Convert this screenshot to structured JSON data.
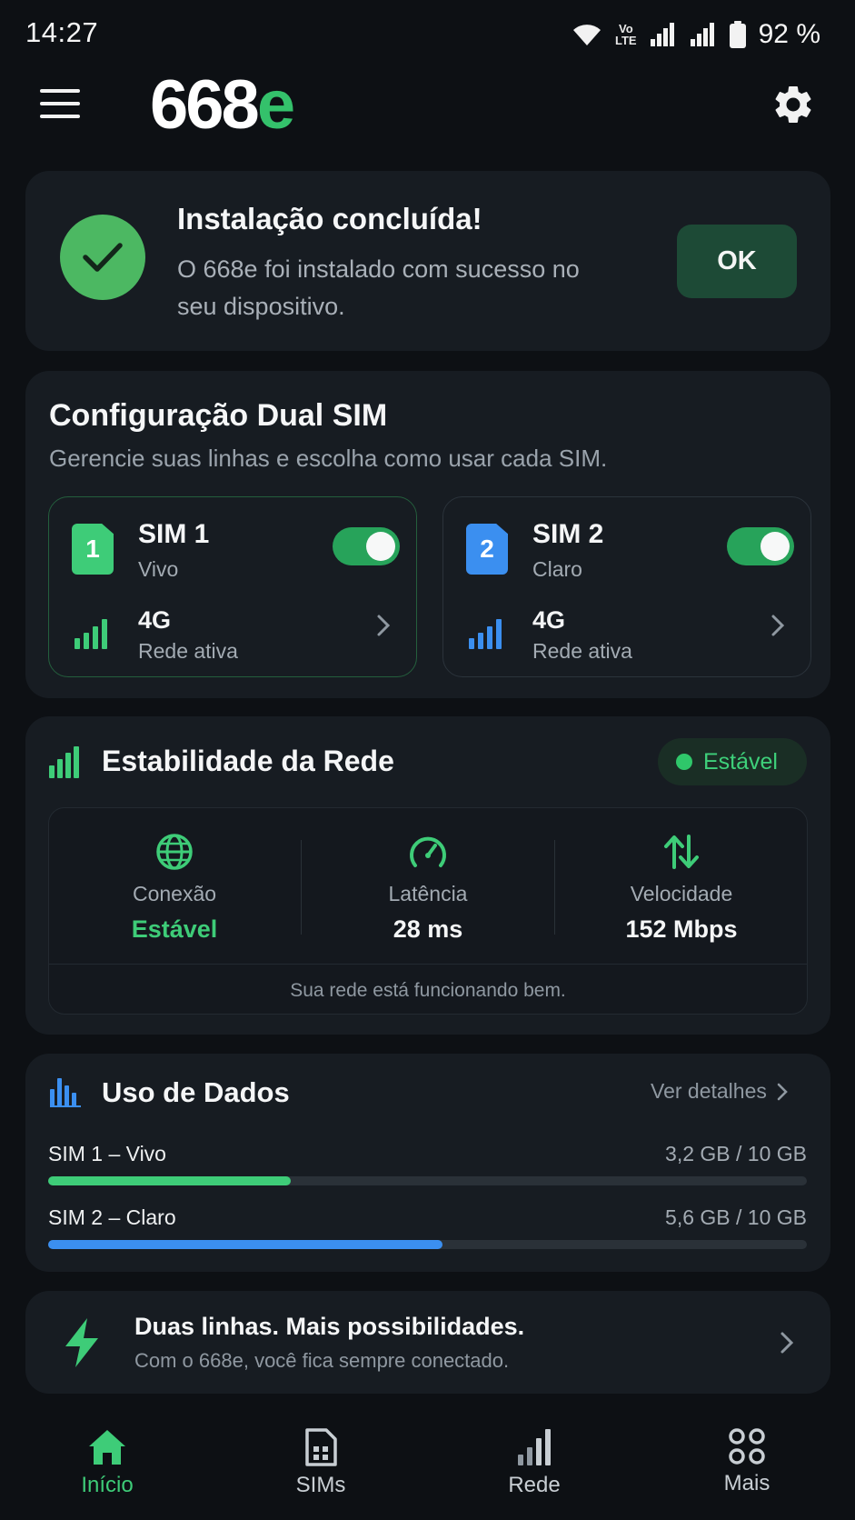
{
  "status_bar": {
    "time": "14:27",
    "volte_top": "Vo",
    "volte_bottom": "LTE",
    "battery": "92 %"
  },
  "header": {
    "logo_main": "668",
    "logo_accent": "e"
  },
  "install": {
    "title": "Instalação concluída!",
    "message": "O 668e foi instalado com sucesso no seu dispositivo.",
    "ok_label": "OK"
  },
  "dual_sim": {
    "title": "Configuração Dual SIM",
    "subtitle": "Gerencie suas linhas e escolha como usar cada SIM.",
    "sims": [
      {
        "badge": "1",
        "name": "SIM 1",
        "carrier": "Vivo",
        "network": "4G",
        "network_status": "Rede ativa",
        "enabled": true,
        "color": "#3ecc78"
      },
      {
        "badge": "2",
        "name": "SIM 2",
        "carrier": "Claro",
        "network": "4G",
        "network_status": "Rede ativa",
        "enabled": true,
        "color": "#3b8ff0"
      }
    ]
  },
  "stability": {
    "title": "Estabilidade da Rede",
    "status": "Estável",
    "metrics": [
      {
        "icon": "globe-icon",
        "label": "Conexão",
        "value": "Estável"
      },
      {
        "icon": "speedometer-icon",
        "label": "Latência",
        "value": "28 ms"
      },
      {
        "icon": "up-down-arrows-icon",
        "label": "Velocidade",
        "value": "152 Mbps"
      }
    ],
    "footer": "Sua rede está funcionando bem."
  },
  "data_usage": {
    "title": "Uso de Dados",
    "details_label": "Ver detalhes",
    "rows": [
      {
        "label": "SIM 1 – Vivo",
        "value": "3,2 GB / 10 GB",
        "fraction": 0.32,
        "color": "#3ecc78"
      },
      {
        "label": "SIM 2 – Claro",
        "value": "5,6 GB / 10 GB",
        "fraction": 0.52,
        "color": "#3b8ff0"
      }
    ]
  },
  "promo": {
    "title": "Duas linhas. Mais possibilidades.",
    "subtitle": "Com o 668e, você fica sempre conectado."
  },
  "bottom_nav": [
    {
      "label": "Início",
      "icon": "home-icon",
      "active": true
    },
    {
      "label": "SIMs",
      "icon": "sim-card-icon",
      "active": false
    },
    {
      "label": "Rede",
      "icon": "signal-icon",
      "active": false
    },
    {
      "label": "Mais",
      "icon": "grid-icon",
      "active": false
    }
  ],
  "colors": {
    "accent": "#3ecc78",
    "blue": "#3b8ff0",
    "background": "#0d1014",
    "card": "#171c22"
  }
}
